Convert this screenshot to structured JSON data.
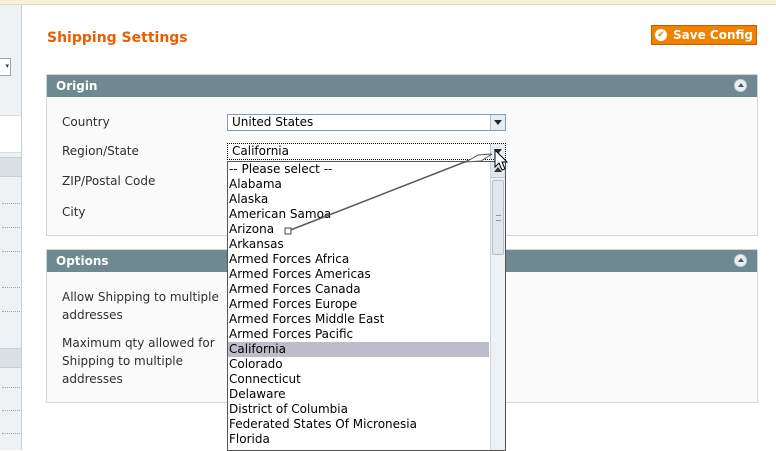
{
  "page": {
    "title": "Shipping Settings",
    "save_label": "Save Config"
  },
  "origin": {
    "header": "Origin",
    "country_label": "Country",
    "country_value": "United States",
    "region_label": "Region/State",
    "region_value": "California",
    "zip_label": "ZIP/Postal Code",
    "city_label": "City"
  },
  "options": {
    "header": "Options",
    "allow_label_1": "Allow Shipping to multiple",
    "allow_label_2": "addresses",
    "maxqty_label_1": "Maximum qty allowed for",
    "maxqty_label_2": "Shipping to multiple",
    "maxqty_label_3": "addresses"
  },
  "region_options": [
    "-- Please select --",
    "Alabama",
    "Alaska",
    "American Samoa",
    "Arizona",
    "Arkansas",
    "Armed Forces Africa",
    "Armed Forces Americas",
    "Armed Forces Canada",
    "Armed Forces Europe",
    "Armed Forces Middle East",
    "Armed Forces Pacific",
    "California",
    "Colorado",
    "Connecticut",
    "Delaware",
    "District of Columbia",
    "Federated States Of Micronesia",
    "Florida"
  ],
  "region_selected_index": 12,
  "colors": {
    "title": "#eb5e00",
    "save_button": "#f18200",
    "fieldset_header": "#6f8992",
    "selected_option": "#bdbdc9"
  },
  "icons": {
    "save": "check-circle-icon",
    "collapse": "collapse-arrow-icon",
    "dropdown": "chevron-down-icon",
    "cursor": "mouse-pointer-icon"
  }
}
